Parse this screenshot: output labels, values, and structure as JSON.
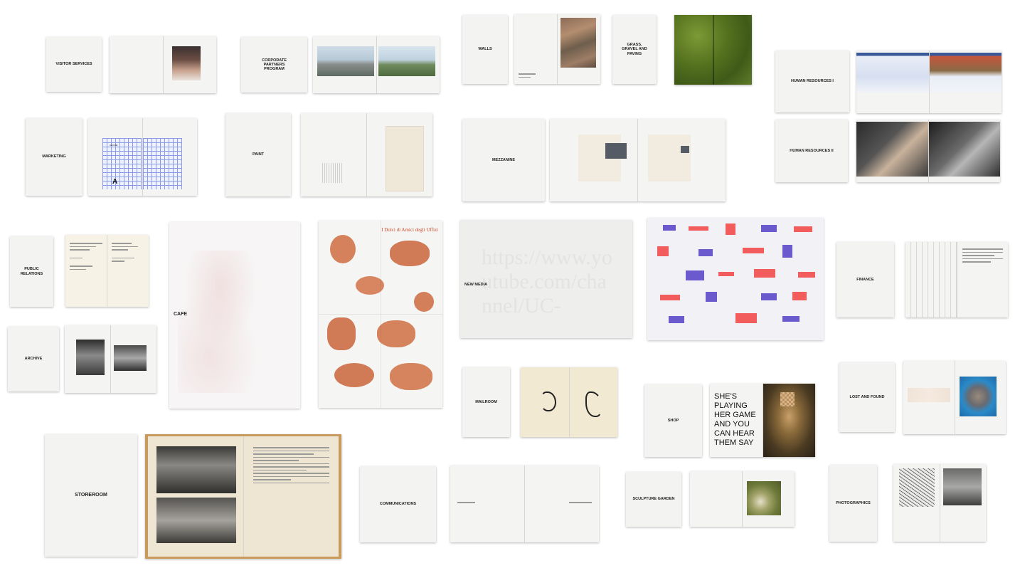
{
  "covers": {
    "visitor_services": "VISITOR SERVICES",
    "corporate_partners": "CORPORATE PARTNERS PROGRAM",
    "walls": "WALLS",
    "grass_gravel": "GRASS, GRAVEL AND PAVING",
    "human_resources_1": "HUMAN RESOURCES I",
    "human_resources_2": "HUMAN RESOURCES II",
    "marketing": "MARKETING",
    "paint": "PAINT",
    "mezzanine": "MEZZANINE",
    "public_relations": "PUBLIC RELATIONS",
    "archive": "ARCHIVE",
    "cafe": "CAFE",
    "new_media": "NEW MEDIA",
    "finance": "FINANCE",
    "mailroom": "MAILROOM",
    "shop": "SHOP",
    "lost_and_found": "LOST AND FOUND",
    "storeroom": "STOREROOM",
    "communications": "COMMUNICATIONS",
    "sculpture_garden": "SCULPTURE GARDEN",
    "photographics": "PHOTOGRAPHICS"
  },
  "spreads": {
    "marketing_label": "AECOM",
    "marketing_letter": "A",
    "cafe_poster_title": "I Dolci di Amici degli Uffizi",
    "new_media_watermark": "https://www.youtube.com/channel/UC-",
    "shop_text": "SHE'S PLAYING HER GAME AND YOU CAN HEAR THEM SAY"
  },
  "colors": {
    "background": "#ffffff",
    "cover": "#f3f3f2",
    "grass": "#5b7a25",
    "pastry": "#c8643a",
    "chart_blue": "#6a5acd",
    "chart_red": "#f25c5c",
    "grid_blue": "#5b6fd6"
  }
}
